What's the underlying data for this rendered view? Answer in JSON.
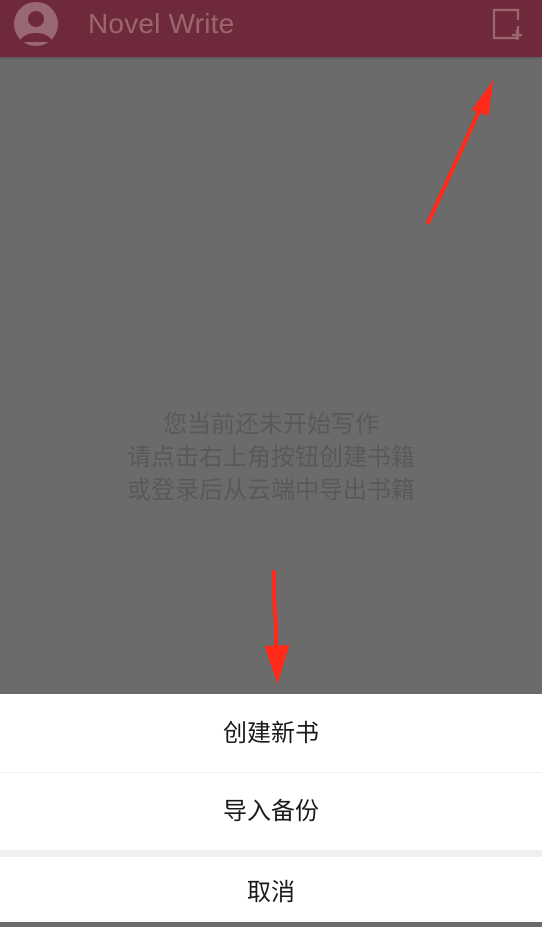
{
  "app_bar": {
    "title": "Novel Write",
    "avatar_icon": "user-avatar-icon",
    "action_icon": "new-book-icon",
    "background_color": "#6e2a3b"
  },
  "empty_state": {
    "line1": "您当前还未开始写作",
    "line2": "请点击右上角按钮创建书籍",
    "line3": "或登录后从云端中导出书籍"
  },
  "action_sheet": {
    "create_label": "创建新书",
    "import_label": "导入备份",
    "cancel_label": "取消"
  },
  "annotations": {
    "arrow_color": "#ff2a1a"
  }
}
